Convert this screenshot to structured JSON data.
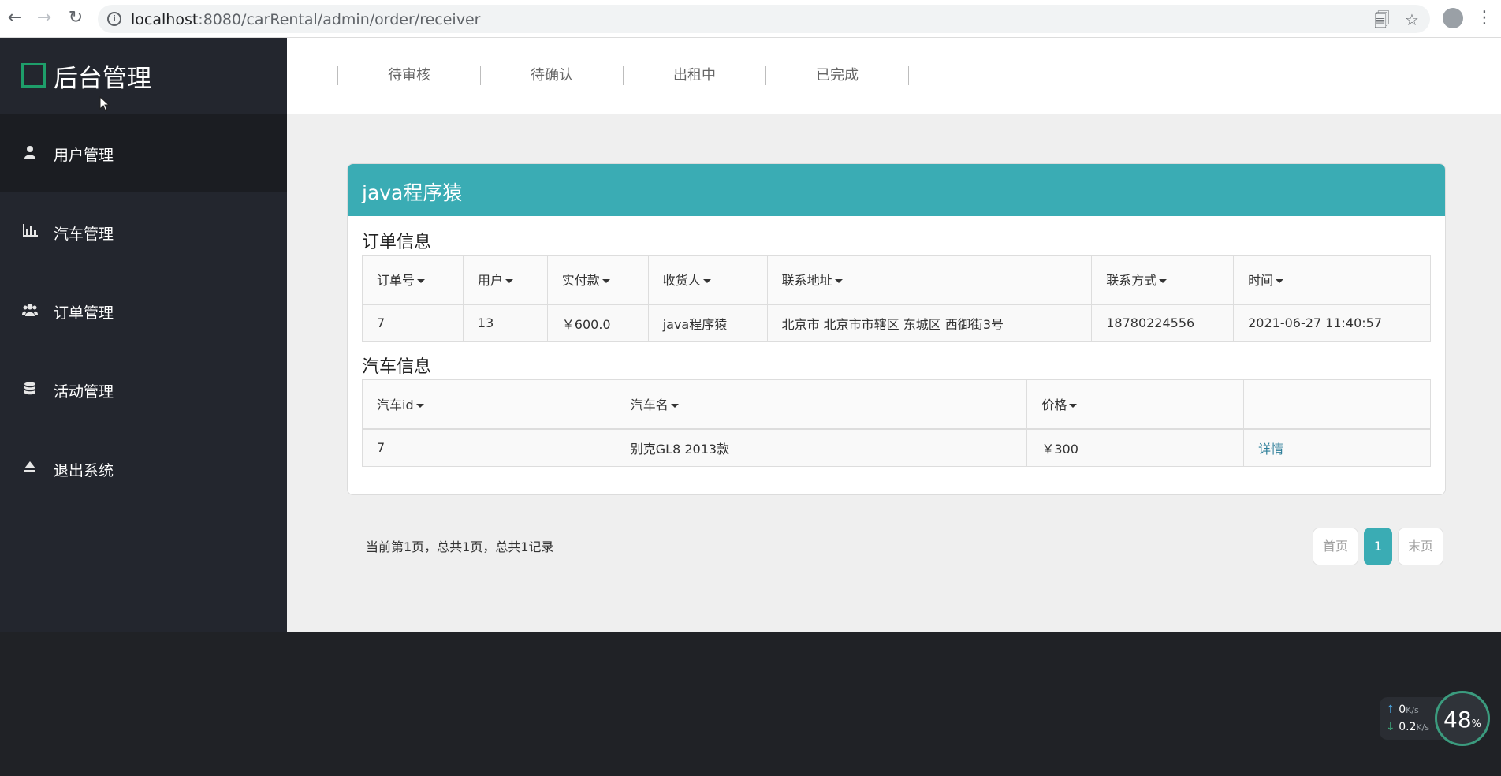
{
  "browser": {
    "url_host": "localhost",
    "url_path": ":8080/carRental/admin/order/receiver"
  },
  "sidebar": {
    "brand_title": "后台管理",
    "items": [
      {
        "label": "用户管理",
        "icon": "user-icon"
      },
      {
        "label": "汽车管理",
        "icon": "bar-chart-icon"
      },
      {
        "label": "订单管理",
        "icon": "users-icon"
      },
      {
        "label": "活动管理",
        "icon": "database-icon"
      },
      {
        "label": "退出系统",
        "icon": "eject-icon"
      }
    ]
  },
  "tabs": [
    "待审核",
    "待确认",
    "出租中",
    "已完成"
  ],
  "panel": {
    "title": "java程序猿",
    "order_section": "订单信息",
    "order_headers": [
      "订单号",
      "用户",
      "实付款",
      "收货人",
      "联系地址",
      "联系方式",
      "时间"
    ],
    "order_rows": [
      [
        "7",
        "13",
        "￥600.0",
        "java程序猿",
        "北京市 北京市市辖区 东城区 西御街3号",
        "18780224556",
        "2021-06-27 11:40:57"
      ]
    ],
    "car_section": "汽车信息",
    "car_headers": [
      "汽车id",
      "汽车名",
      "价格",
      ""
    ],
    "car_rows": [
      [
        "7",
        "别克GL8 2013款",
        "￥300",
        "详情"
      ]
    ]
  },
  "pagination": {
    "info": "当前第1页，总共1页，总共1记录",
    "first": "首页",
    "current": "1",
    "last": "末页"
  },
  "speed_widget": {
    "up": "0",
    "up_unit": "K/s",
    "down": "0.2",
    "down_unit": "K/s",
    "percent": "48",
    "percent_unit": "%"
  },
  "colors": {
    "accent": "#3aacb4",
    "sidebar": "#23262e",
    "logo": "#1e9e6a"
  }
}
